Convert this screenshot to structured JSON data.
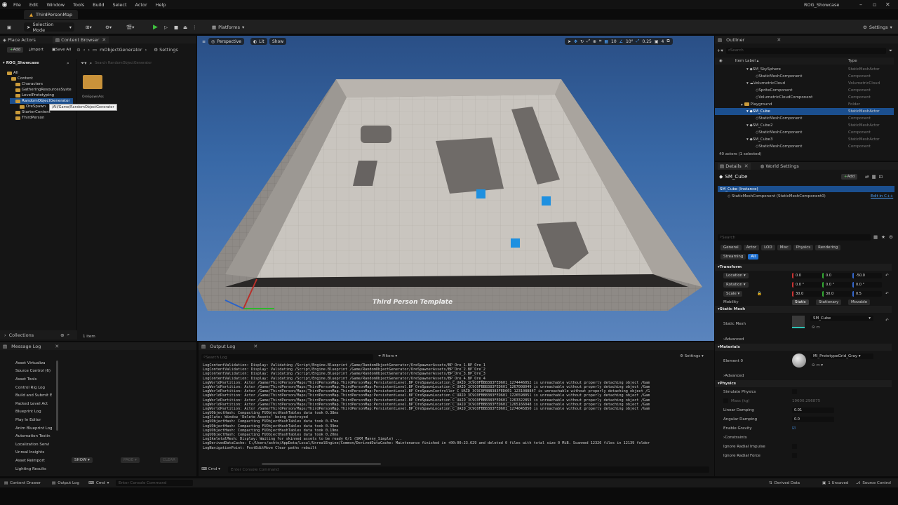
{
  "menu": {
    "items": [
      "File",
      "Edit",
      "Window",
      "Tools",
      "Build",
      "Select",
      "Actor",
      "Help"
    ]
  },
  "window": {
    "project": "ROG_Showcase",
    "map_tab": "ThirdPersonMap"
  },
  "toolbar": {
    "selection_mode": "Selection Mode",
    "platforms": "Platforms",
    "settings": "Settings"
  },
  "left": {
    "tab_place": "Place Actors",
    "tab_cb": "Content Browser",
    "add": "Add",
    "import": "Import",
    "save_all": "Save All",
    "path": "mObjectGenerator",
    "settings": "Settings",
    "root": "ROG_Showcase",
    "search_placeholder": "Search RandomObjectGenerator",
    "tree": [
      "All",
      "Content",
      "Characters",
      "GatheringResourcesSyste",
      "LevelPrototyping",
      "RandomObjectGenerator",
      "OreSpawn",
      "StarterContent",
      "ThirdPerson"
    ],
    "tooltip": "/All/Game/RandomObjectGenerator",
    "folder_label": "OreSpawnAss",
    "item_count": "1 item",
    "collections": "Collections"
  },
  "viewport": {
    "perspective": "Perspective",
    "lit": "Lit",
    "show": "Show",
    "grid": "10",
    "angle": "10°",
    "scale": "0.25",
    "cams": "4",
    "floor_text": "Third Person Template"
  },
  "outliner": {
    "title": "Outliner",
    "search_placeholder": "Search",
    "col_label": "Item Label",
    "col_type": "Type",
    "rows": [
      {
        "label": "SM_SkySphere",
        "type": "StaticMeshActor"
      },
      {
        "label": "StaticMeshComponent",
        "type": "Component"
      },
      {
        "label": "VolumetricCloud",
        "type": "VolumetricCloud"
      },
      {
        "label": "SpriteComponent",
        "type": "Component"
      },
      {
        "label": "VolumetricCloudComponent",
        "type": "Component"
      },
      {
        "label": "Playground",
        "type": "Folder"
      },
      {
        "label": "SM_Cube",
        "type": "StaticMeshActor"
      },
      {
        "label": "StaticMeshComponent",
        "type": "Component"
      },
      {
        "label": "SM_Cube2",
        "type": "StaticMeshActor"
      },
      {
        "label": "StaticMeshComponent",
        "type": "Component"
      },
      {
        "label": "SM_Cube3",
        "type": "StaticMeshActor"
      },
      {
        "label": "StaticMeshComponent",
        "type": "Component"
      }
    ],
    "footer": "40 actors (1 selected)"
  },
  "details": {
    "tab_details": "Details",
    "tab_world": "World Settings",
    "actor": "SM_Cube",
    "add": "Add",
    "instance": "SM_Cube (Instance)",
    "component": "StaticMeshComponent (StaticMeshComponent0)",
    "edit_cpp": "Edit in C++",
    "search_placeholder": "Search",
    "filters1": [
      "General",
      "Actor",
      "LOD",
      "Misc",
      "Physics",
      "Rendering"
    ],
    "filters2": [
      "Streaming",
      "All"
    ],
    "transform": "Transform",
    "location": "Location",
    "rotation": "Rotation",
    "scale": "Scale",
    "loc_vals": [
      "0.0",
      "0.0",
      "-50.0"
    ],
    "rot_vals": [
      "0.0 °",
      "0.0 °",
      "0.0 °"
    ],
    "scale_vals": [
      "30.0",
      "30.0",
      "0.5"
    ],
    "mobility": "Mobility",
    "mobility_opts": [
      "Static",
      "Stationary",
      "Movable"
    ],
    "static_mesh_sect": "Static Mesh",
    "static_mesh": "Static Mesh",
    "mesh_value": "SM_Cube",
    "advanced": "Advanced",
    "materials": "Materials",
    "element0": "Element 0",
    "material_value": "MI_PrototypeGrid_Gray",
    "physics": "Physics",
    "simulate": "Simulate Physics",
    "mass": "Mass (kg)",
    "mass_val": "19600.296875",
    "linear_damping": "Linear Damping",
    "linear_val": "0.01",
    "angular_damping": "Angular Damping",
    "angular_val": "0.0",
    "enable_gravity": "Enable Gravity",
    "constraints": "Constraints",
    "ignore_impulse": "Ignore Radial Impulse",
    "ignore_force": "Ignore Radial Force"
  },
  "message_log": {
    "title": "Message Log",
    "items": [
      "Asset Virtualiza",
      "Source Control (6)",
      "Asset Tools",
      "Control Rig Log",
      "Build and Submit E",
      "Packed Level Act",
      "Blueprint Log",
      "Play In Editor",
      "Anim Blueprint Log",
      "Automation Testin",
      "Localization Servi",
      "Unreal Insights",
      "Asset Reimport",
      "Lighting Results"
    ],
    "show": "SHOW",
    "pages": "PAGE",
    "clear": "CLEAR"
  },
  "output_log": {
    "title": "Output Log",
    "search_placeholder": "Search Log",
    "filters": "Filters",
    "settings": "Settings",
    "lines": [
      "LogContentValidation: Display: Validating /Script/Engine.Blueprint /Game/RandomObjectGenerator/OreSpawnerAssets/BP_Ore_1.BP_Ore_1",
      "LogContentValidation: Display: Validating /Script/Engine.Blueprint /Game/RandomObjectGenerator/OreSpawnerAssets/BP_Ore_2.BP_Ore_2",
      "LogContentValidation: Display: Validating /Script/Engine.Blueprint /Game/RandomObjectGenerator/OreSpawnerAssets/BP_Ore_3.BP_Ore_3",
      "LogContentValidation: Display: Validating /Script/Engine.Blueprint /Game/RandomObjectGenerator/OreSpawnerAssets/BP_Ore_4.BP_Ore_4",
      "LogWorldPartition: Actor /Game/ThirdPerson/Maps/ThirdPersonMap.ThirdPersonMap:PersistentLevel.BP_OreSpawnLocation_C_UAID_3C9C0FBBB383FED601_1274446052 is unreachable without properly detaching object /Gam",
      "LogWorldPartition: Actor /Game/ThirdPerson/Maps/ThirdPersonMap.ThirdPersonMap:PersistentLevel.BP_OreSpawnLocation_C_UAID_3C9C0FBBB383FED601_1267008049 is unreachable without properly detaching object /Gam",
      "LogWorldPartition: Actor /Game/ThirdPerson/Maps/ThirdPersonMap.ThirdPersonMap:PersistentLevel.BP_OreSpawnController_C_UAID_3C9C0FBBB383FED601_1231088847 is unreachable without properly detaching object /G",
      "LogWorldPartition: Actor /Game/ThirdPerson/Maps/ThirdPersonMap.ThirdPersonMap:PersistentLevel.BP_OreSpawnLocation_C_UAID_3C9C0FBBB383FED601_1226598051 is unreachable without properly detaching object /Gam",
      "LogWorldPartition: Actor /Game/ThirdPerson/Maps/ThirdPersonMap.ThirdPersonMap:PersistentLevel.BP_OreSpawnLocation_C_UAID_3C9C0FBBB383FED601_1263322853 is unreachable without properly detaching object /Gam",
      "LogWorldPartition: Actor /Game/ThirdPerson/Maps/ThirdPersonMap.ThirdPersonMap:PersistentLevel.BP_OreSpawnLocation_C_UAID_3C9C0FBBB383FED601_1265166048 is unreachable without properly detaching object /Gam",
      "LogWorldPartition: Actor /Game/ThirdPerson/Maps/ThirdPersonMap.ThirdPersonMap:PersistentLevel.BP_OreSpawnLocation_C_UAID_3C9C0FBBB383FED601_1274045850 is unreachable without properly detaching object /Gam",
      "LogUObjectHash: Compacting FUObjectHashTables data took   0.38ms",
      "LogSlate: Window 'Delete Assets' being destroyed",
      "LogUObjectHash: Compacting FUObjectHashTables data took   0.47ms",
      "LogUObjectHash: Compacting FUObjectHashTables data took   0.39ms",
      "LogUObjectHash: Compacting FUObjectHashTables data took   0.19ms",
      "LogUObjectHash: Compacting FUObjectHashTables data took   0.20ms",
      "LogSkeletalMesh: Display: Waiting for skinned assets to be ready 0/1 (SKM_Manny_Simple) ...",
      "LogDerivedDataCache: C:/Users/ashto/AppData/Local/UnrealEngine/Common/DerivedDataCache: Maintenance finished in +00:00:23.629 and deleted 0 files with total size 0 MiB. Scanned 12326 files in 12139 folder",
      "LogNavigationPoint: PostEditMove Clear paths rebuilt"
    ],
    "cmd": "Cmd",
    "cmd_placeholder": "Enter Console Command"
  },
  "status": {
    "content_drawer": "Content Drawer",
    "output_log": "Output Log",
    "cmd": "Cmd",
    "console_placeholder": "Enter Console Command",
    "derived": "Derived Data",
    "unsaved": "1 Unsaved",
    "source_control": "Source Control"
  }
}
